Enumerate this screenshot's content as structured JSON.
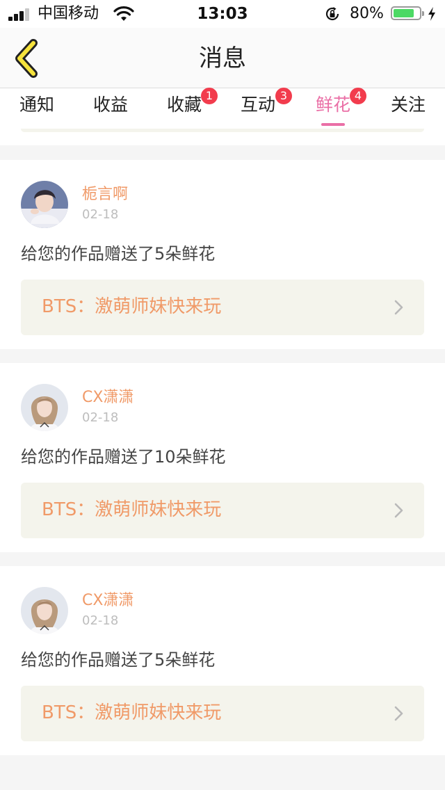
{
  "status_bar": {
    "carrier": "中国移动",
    "time": "13:03",
    "battery_percent": "80%",
    "battery_level": 0.8,
    "signal_bars_filled": 3,
    "signal_bars_total": 4
  },
  "header": {
    "title": "消息"
  },
  "tabs": [
    {
      "label": "通知",
      "badge": ""
    },
    {
      "label": "收益",
      "badge": ""
    },
    {
      "label": "收藏",
      "badge": "1"
    },
    {
      "label": "互动",
      "badge": "3"
    },
    {
      "label": "鲜花",
      "badge": "4"
    },
    {
      "label": "关注",
      "badge": ""
    }
  ],
  "active_tab": "鲜花",
  "feed": [
    {
      "user": "栀言啊",
      "time": "02-18",
      "message": "给您的作品赠送了5朵鲜花",
      "work": "BTS：激萌师妹快来玩"
    },
    {
      "user": "CX潇潇",
      "time": "02-18",
      "message": "给您的作品赠送了10朵鲜花",
      "work": "BTS：激萌师妹快来玩"
    },
    {
      "user": "CX潇潇",
      "time": "02-18",
      "message": "给您的作品赠送了5朵鲜花",
      "work": "BTS：激萌师妹快来玩"
    }
  ],
  "colors": {
    "accent_pink": "#ea6fa6",
    "name_orange": "#f09a68",
    "badge_red": "#f23c4d",
    "back_arrow_yellow": "#f6e33c",
    "battery_green": "#4cd964"
  }
}
